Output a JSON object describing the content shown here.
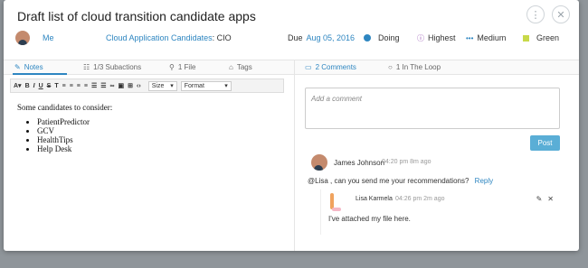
{
  "title": "Draft list of cloud transition candidate apps",
  "top_buttons": {
    "more": "⋮",
    "close": "✕"
  },
  "meta": {
    "owner": "Me",
    "project": "Cloud Application Candidates",
    "project_suffix": " : CIO",
    "due_label": "Due",
    "due_date": "Aug 05, 2016",
    "status": "Doing",
    "priority": "Highest",
    "effort": "Medium",
    "color_label": "Green"
  },
  "tabs": {
    "notes": "Notes",
    "subactions": "1/3 Subactions",
    "files": "1 File",
    "tags": "Tags",
    "comments": "2 Comments",
    "loop": "1 In The Loop"
  },
  "toolbar": {
    "size": "Size",
    "format": "Format"
  },
  "editor": {
    "intro": "Some candidates to consider:",
    "items": [
      "PatientPredictor",
      "GCV",
      "HealthTips",
      "Help Desk"
    ]
  },
  "comment_input": {
    "placeholder": "Add a comment"
  },
  "post_button": "Post",
  "comments": [
    {
      "author": "James Johnson",
      "time": "04:20 pm 8m ago",
      "body": "@Lisa , can you send me your recommendations?",
      "reply_label": "Reply"
    }
  ],
  "reply": {
    "author": "Lisa Karmela",
    "time": "04:26 pm 2m ago",
    "body": "I've attached my file here."
  },
  "colors": {
    "accent": "#2e86c1",
    "post_button": "#5aaed6",
    "status_doing": "#2e86c1",
    "priority_highest": "#8e44ad",
    "color_green_tag": "#c8d94a"
  }
}
